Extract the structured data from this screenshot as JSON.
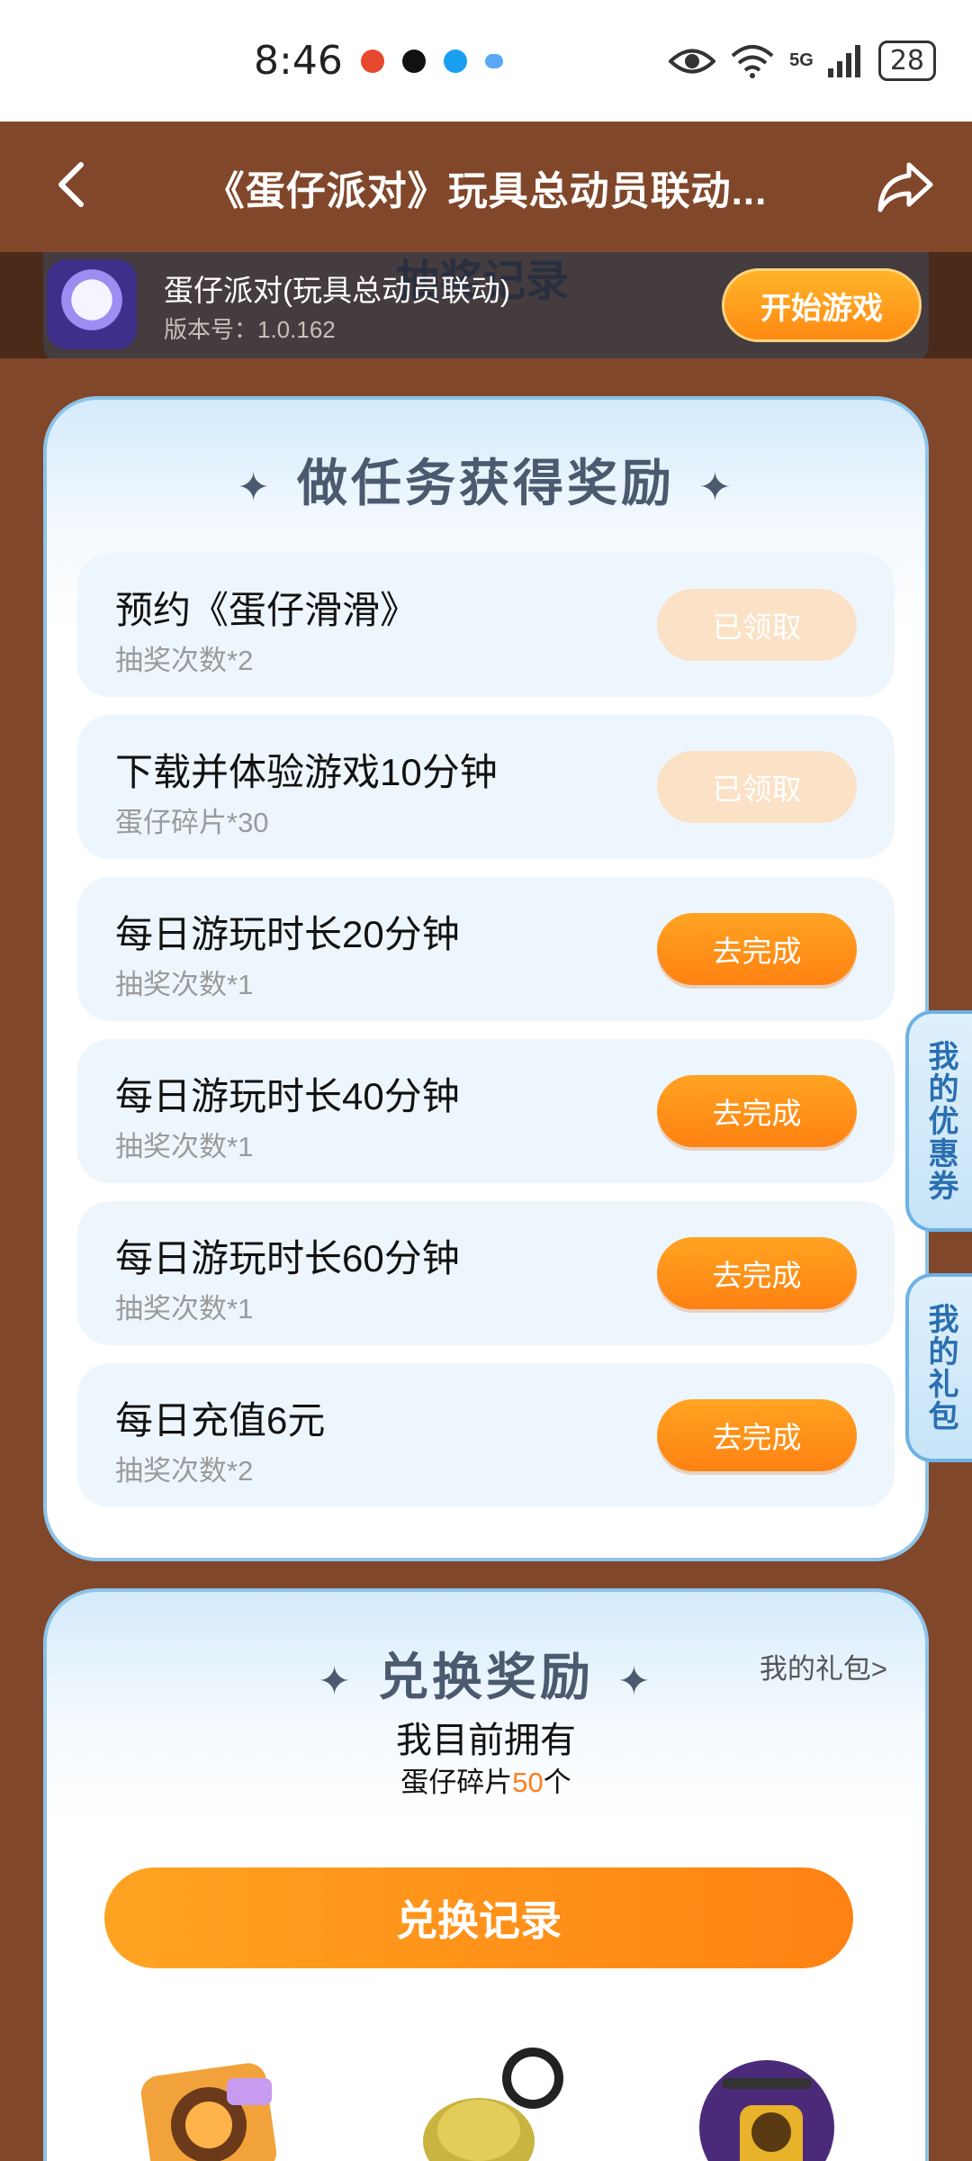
{
  "status_bar": {
    "time": "8:46",
    "network": "5G",
    "battery": "28",
    "notif_colors": [
      "#e6492d",
      "#111111",
      "#1aa0f0",
      "#5aa8f5"
    ]
  },
  "header": {
    "title": "《蛋仔派对》玩具总动员联动..."
  },
  "game_bar": {
    "background_text": "抽奖记录",
    "name": "蛋仔派对(玩具总动员联动)",
    "version": "版本号：1.0.162",
    "start_button": "开始游戏"
  },
  "tasks": {
    "title": "做任务获得奖励",
    "items": [
      {
        "name": "预约《蛋仔滑滑》",
        "reward": "抽奖次数*2",
        "button": "已领取",
        "state": "done"
      },
      {
        "name": "下载并体验游戏10分钟",
        "reward": "蛋仔碎片*30",
        "button": "已领取",
        "state": "done"
      },
      {
        "name": "每日游玩时长20分钟",
        "reward": "抽奖次数*1",
        "button": "去完成",
        "state": "todo"
      },
      {
        "name": "每日游玩时长40分钟",
        "reward": "抽奖次数*1",
        "button": "去完成",
        "state": "todo"
      },
      {
        "name": "每日游玩时长60分钟",
        "reward": "抽奖次数*1",
        "button": "去完成",
        "state": "todo"
      },
      {
        "name": "每日充值6元",
        "reward": "抽奖次数*2",
        "button": "去完成",
        "state": "todo"
      }
    ]
  },
  "side_tabs": {
    "coupons": "我的优惠券",
    "gifts": "我的礼包"
  },
  "exchange": {
    "title": "兑换奖励",
    "my_gift_link": "我的礼包>",
    "own_title": "我目前拥有",
    "own_prefix": "蛋仔碎片",
    "own_count": "50",
    "own_suffix": "个",
    "record_button": "兑换记录"
  },
  "colors": {
    "background": "#81472a",
    "accent_orange": "#ff8a12",
    "card_border": "#8cc4ea"
  }
}
